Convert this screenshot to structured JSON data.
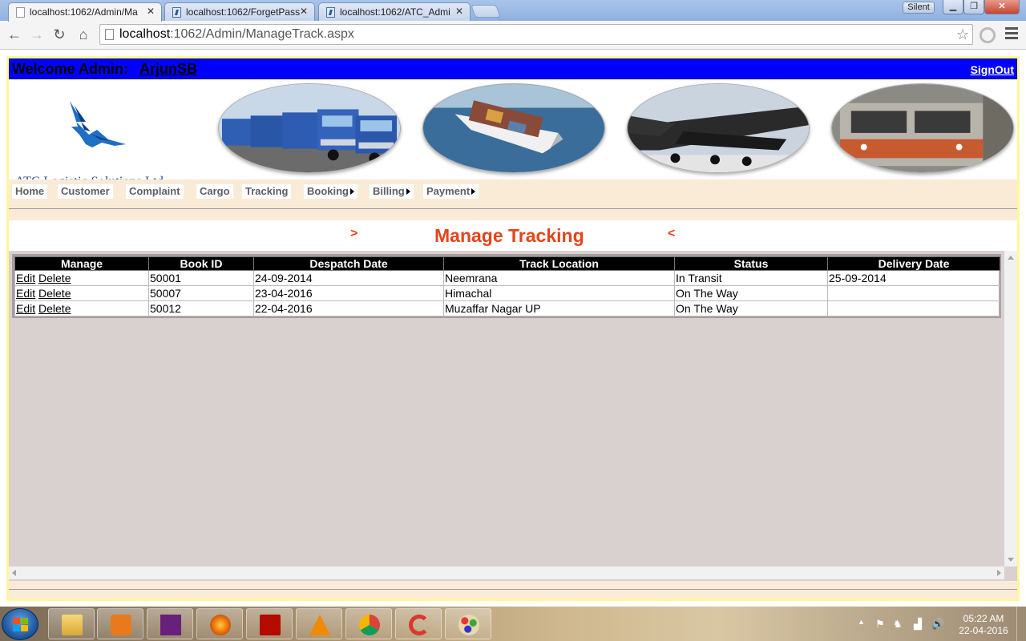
{
  "browser": {
    "tabs": [
      {
        "label": "localhost:1062/Admin/Ma",
        "active": true
      },
      {
        "label": "localhost:1062/ForgetPass",
        "active": false
      },
      {
        "label": "localhost:1062/ATC_Admi",
        "active": false
      }
    ],
    "silent_label": "Silent",
    "url_host": "localhost",
    "url_path": ":1062/Admin/ManageTrack.aspx"
  },
  "header": {
    "welcome_label": "Welcome Admin:",
    "username": "ArjunSB",
    "signout": "SignOut",
    "company": "ATC Logistic Solutions Ltd.,"
  },
  "menu": [
    {
      "label": "Home",
      "submenu": false
    },
    {
      "label": "Customer",
      "submenu": false
    },
    {
      "label": "Complaint",
      "submenu": false
    },
    {
      "label": "Cargo",
      "submenu": false
    },
    {
      "label": "Tracking",
      "submenu": false
    },
    {
      "label": "Booking",
      "submenu": true
    },
    {
      "label": "Billing",
      "submenu": true
    },
    {
      "label": "Payment",
      "submenu": true
    }
  ],
  "page": {
    "title": "Manage Tracking",
    "left_marker": ">",
    "right_marker": "<"
  },
  "grid": {
    "columns": [
      "Manage",
      "Book ID",
      "Despatch Date",
      "Track Location",
      "Status",
      "Delivery Date"
    ],
    "edit_label": "Edit",
    "delete_label": "Delete",
    "rows": [
      {
        "book_id": "50001",
        "despatch_date": "24-09-2014",
        "track_location": "Neemrana",
        "status": "In Transit",
        "delivery_date": "25-09-2014"
      },
      {
        "book_id": "50007",
        "despatch_date": "23-04-2016",
        "track_location": "Himachal",
        "status": "On The Way",
        "delivery_date": ""
      },
      {
        "book_id": "50012",
        "despatch_date": "22-04-2016",
        "track_location": "Muzaffar Nagar UP",
        "status": "On The Way",
        "delivery_date": ""
      }
    ]
  },
  "taskbar": {
    "time": "05:22 AM",
    "date": "22-04-2016",
    "apps": [
      "file-explorer-icon",
      "media-player-icon",
      "visual-studio-icon",
      "firefox-icon",
      "acrobat-icon",
      "vlc-icon",
      "chrome-icon",
      "ccleaner-icon",
      "paint-icon"
    ]
  },
  "colors": {
    "welcome_bar": "#0000ff",
    "title": "#e8431a",
    "menu_strip": "#faebd7",
    "grid_panel": "#d9d0d0",
    "frame_border": "#fff799"
  }
}
